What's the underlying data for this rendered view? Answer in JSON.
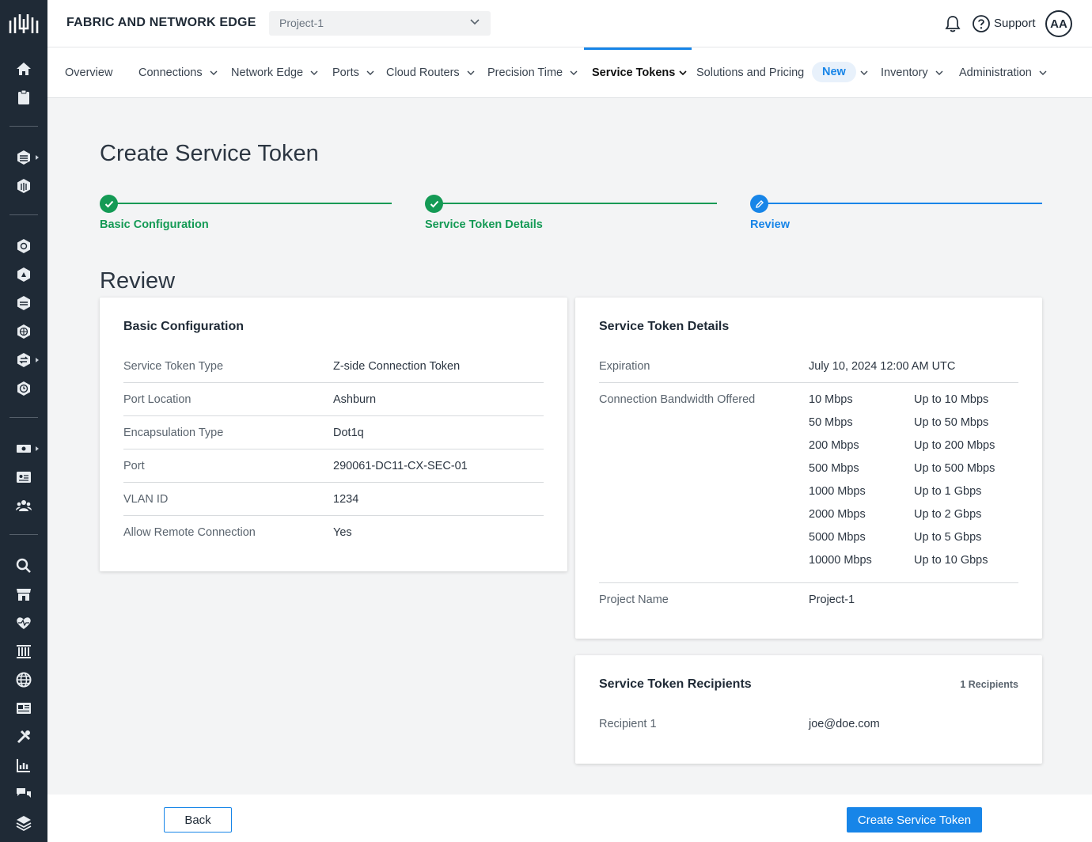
{
  "header": {
    "app_title": "FABRIC AND NETWORK EDGE",
    "project": "Project-1",
    "support_label": "Support",
    "avatar_initials": "AA"
  },
  "nav": {
    "items": [
      {
        "label": "Overview",
        "dropdown": false
      },
      {
        "label": "Connections",
        "dropdown": true
      },
      {
        "label": "Network Edge",
        "dropdown": true
      },
      {
        "label": "Ports",
        "dropdown": true
      },
      {
        "label": "Cloud Routers",
        "dropdown": true
      },
      {
        "label": "Precision Time",
        "dropdown": true
      },
      {
        "label": "Service Tokens",
        "dropdown": true,
        "active": true
      },
      {
        "label": "Solutions and Pricing",
        "dropdown": true
      },
      {
        "label": "Inventory",
        "dropdown": true
      },
      {
        "label": "Administration",
        "dropdown": true
      }
    ],
    "new_badge": "New"
  },
  "page": {
    "title": "Create Service Token",
    "review_heading": "Review"
  },
  "steps": [
    {
      "label": "Basic Configuration",
      "state": "complete"
    },
    {
      "label": "Service Token Details",
      "state": "complete"
    },
    {
      "label": "Review",
      "state": "current"
    }
  ],
  "basic_config": {
    "title": "Basic Configuration",
    "rows": [
      {
        "key": "Service Token Type",
        "value": "Z-side Connection Token"
      },
      {
        "key": "Port Location",
        "value": "Ashburn"
      },
      {
        "key": "Encapsulation Type",
        "value": "Dot1q"
      },
      {
        "key": "Port",
        "value": "290061-DC11-CX-SEC-01"
      },
      {
        "key": "VLAN ID",
        "value": "1234"
      },
      {
        "key": "Allow Remote Connection",
        "value": "Yes"
      }
    ]
  },
  "token_details": {
    "title": "Service Token Details",
    "expiration_label": "Expiration",
    "expiration_value": "July 10, 2024 12:00 AM UTC",
    "bandwidth_label": "Connection Bandwidth Offered",
    "bandwidths": [
      {
        "speed": "10 Mbps",
        "limit": "Up to 10 Mbps"
      },
      {
        "speed": "50 Mbps",
        "limit": "Up to 50 Mbps"
      },
      {
        "speed": "200 Mbps",
        "limit": "Up to 200 Mbps"
      },
      {
        "speed": "500 Mbps",
        "limit": "Up to 500 Mbps"
      },
      {
        "speed": "1000 Mbps",
        "limit": "Up to 1 Gbps"
      },
      {
        "speed": "2000 Mbps",
        "limit": "Up to 2 Gbps"
      },
      {
        "speed": "5000 Mbps",
        "limit": "Up to 5 Gbps"
      },
      {
        "speed": "10000 Mbps",
        "limit": "Up to 10 Gbps"
      }
    ],
    "project_label": "Project Name",
    "project_value": "Project-1"
  },
  "recipients": {
    "title": "Service Token Recipients",
    "count_label": "1 Recipients",
    "items": [
      {
        "key": "Recipient 1",
        "value": "joe@doe.com"
      }
    ]
  },
  "footer": {
    "back_label": "Back",
    "create_label": "Create Service Token"
  },
  "colors": {
    "rail": "#1f2a36",
    "accent_blue": "#1785e8",
    "success_green": "#149a55"
  }
}
